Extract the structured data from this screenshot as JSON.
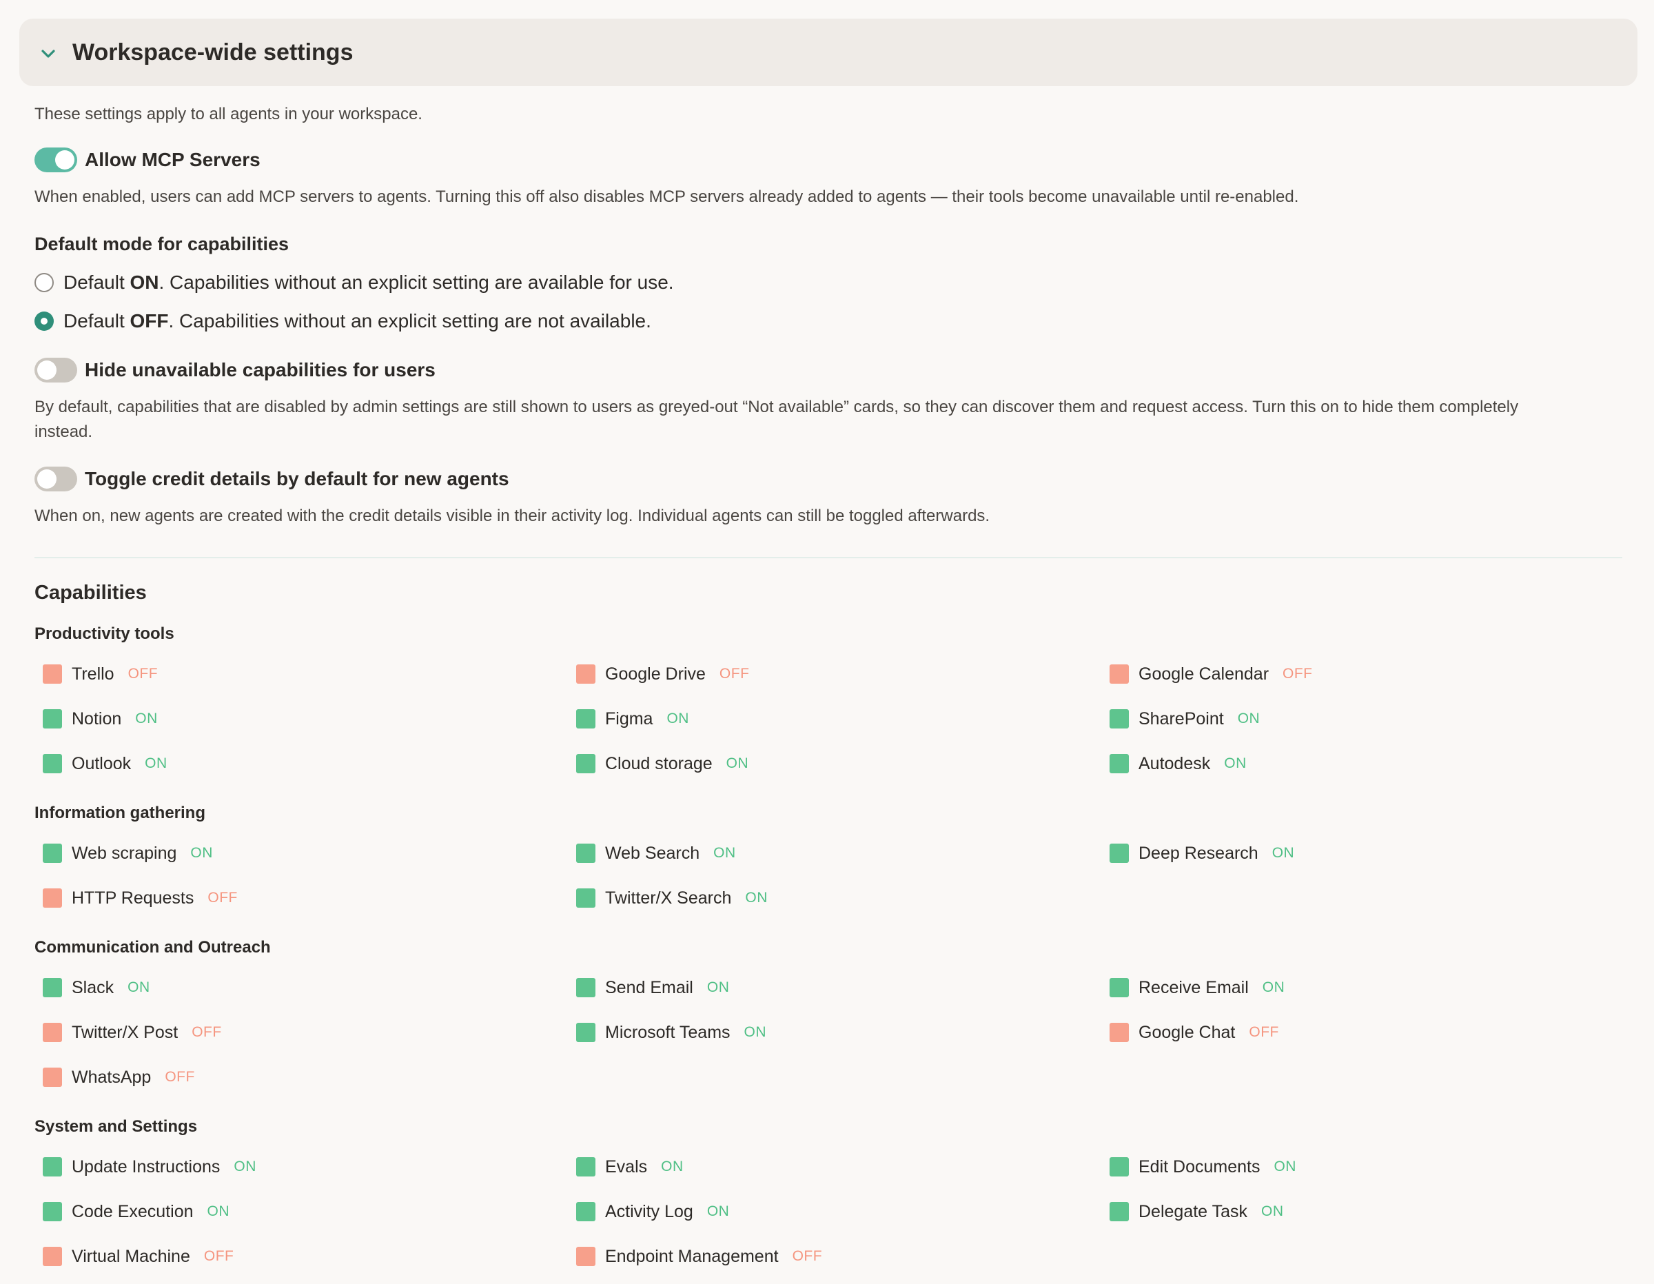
{
  "section": {
    "title": "Workspace-wide settings",
    "intro": "These settings apply to all agents in your workspace."
  },
  "mcp": {
    "label": "Allow MCP Servers",
    "enabled": true,
    "description": "When enabled, users can add MCP servers to agents. Turning this off also disables MCP servers already added to agents — their tools become unavailable until re-enabled."
  },
  "default_mode": {
    "heading": "Default mode for capabilities",
    "options": [
      {
        "prefix": "Default ",
        "bold": "ON",
        "rest": ". Capabilities without an explicit setting are available for use.",
        "selected": false
      },
      {
        "prefix": "Default ",
        "bold": "OFF",
        "rest": ". Capabilities without an explicit setting are not available.",
        "selected": true
      }
    ]
  },
  "hide_unavailable": {
    "label": "Hide unavailable capabilities for users",
    "enabled": false,
    "description_line1": "By default, capabilities that are disabled by admin settings are still shown to users as greyed-out “Not available” cards, so they can discover them and request access. Turn this on to hide them completely",
    "description_line2": "instead."
  },
  "credit_details": {
    "label": "Toggle credit details by default for new agents",
    "enabled": false,
    "description": "When on, new agents are created with the credit details visible in their activity log. Individual agents can still be toggled afterwards."
  },
  "capabilities": {
    "title": "Capabilities",
    "groups": [
      {
        "name": "Productivity tools",
        "items": [
          {
            "name": "Trello",
            "state": "OFF"
          },
          {
            "name": "Google Drive",
            "state": "OFF"
          },
          {
            "name": "Google Calendar",
            "state": "OFF"
          },
          {
            "name": "Notion",
            "state": "ON"
          },
          {
            "name": "Figma",
            "state": "ON"
          },
          {
            "name": "SharePoint",
            "state": "ON"
          },
          {
            "name": "Outlook",
            "state": "ON"
          },
          {
            "name": "Cloud storage",
            "state": "ON"
          },
          {
            "name": "Autodesk",
            "state": "ON"
          }
        ]
      },
      {
        "name": "Information gathering",
        "items": [
          {
            "name": "Web scraping",
            "state": "ON"
          },
          {
            "name": "Web Search",
            "state": "ON"
          },
          {
            "name": "Deep Research",
            "state": "ON"
          },
          {
            "name": "HTTP Requests",
            "state": "OFF"
          },
          {
            "name": "Twitter/X Search",
            "state": "ON"
          }
        ]
      },
      {
        "name": "Communication and Outreach",
        "items": [
          {
            "name": "Slack",
            "state": "ON"
          },
          {
            "name": "Send Email",
            "state": "ON"
          },
          {
            "name": "Receive Email",
            "state": "ON"
          },
          {
            "name": "Twitter/X Post",
            "state": "OFF"
          },
          {
            "name": "Microsoft Teams",
            "state": "ON"
          },
          {
            "name": "Google Chat",
            "state": "OFF"
          },
          {
            "name": "WhatsApp",
            "state": "OFF"
          }
        ]
      },
      {
        "name": "System and Settings",
        "items": [
          {
            "name": "Update Instructions",
            "state": "ON"
          },
          {
            "name": "Evals",
            "state": "ON"
          },
          {
            "name": "Edit Documents",
            "state": "ON"
          },
          {
            "name": "Code Execution",
            "state": "ON"
          },
          {
            "name": "Activity Log",
            "state": "ON"
          },
          {
            "name": "Delegate Task",
            "state": "ON"
          },
          {
            "name": "Virtual Machine",
            "state": "OFF"
          },
          {
            "name": "Endpoint Management",
            "state": "OFF"
          }
        ]
      }
    ]
  },
  "colors": {
    "toggle_on": "#5cbaa4",
    "toggle_off": "#cbc6bf",
    "radio_checked": "#2f8f7a",
    "cap_on": "#5ec48e",
    "cap_off": "#f7a08b"
  }
}
